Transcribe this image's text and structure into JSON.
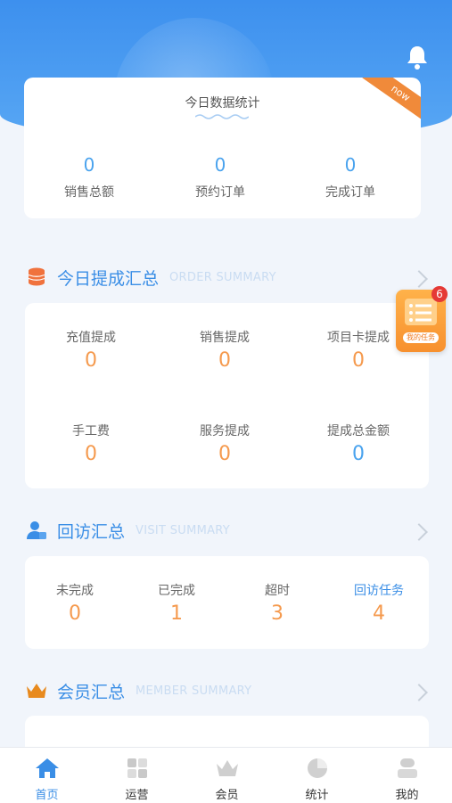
{
  "top": {
    "title": "今日数据统计",
    "ribbon": "now",
    "stats": [
      {
        "value": "0",
        "label": "销售总额"
      },
      {
        "value": "0",
        "label": "预约订单"
      },
      {
        "value": "0",
        "label": "完成订单"
      }
    ]
  },
  "commission": {
    "title": "今日提成汇总",
    "subtitle": "ORDER SUMMARY",
    "items": [
      {
        "label": "充值提成",
        "value": "0"
      },
      {
        "label": "销售提成",
        "value": "0"
      },
      {
        "label": "项目卡提成",
        "value": "0"
      },
      {
        "label": "手工费",
        "value": "0"
      },
      {
        "label": "服务提成",
        "value": "0"
      },
      {
        "label": "提成总金额",
        "value": "0"
      }
    ]
  },
  "visit": {
    "title": "回访汇总",
    "subtitle": "VISIT SUMMARY",
    "items": [
      {
        "label": "未完成",
        "value": "0"
      },
      {
        "label": "已完成",
        "value": "1"
      },
      {
        "label": "超时",
        "value": "3"
      },
      {
        "label": "回访任务",
        "value": "4"
      }
    ]
  },
  "member": {
    "title": "会员汇总",
    "subtitle": "MEMBER SUMMARY"
  },
  "task_float": {
    "badge": "6",
    "label": "我的任务"
  },
  "tabs": [
    {
      "label": "首页",
      "icon": "home-icon",
      "active": true
    },
    {
      "label": "运营",
      "icon": "grid-icon",
      "active": false
    },
    {
      "label": "会员",
      "icon": "crown-icon",
      "active": false
    },
    {
      "label": "统计",
      "icon": "pie-chart-icon",
      "active": false
    },
    {
      "label": "我的",
      "icon": "user-icon",
      "active": false
    }
  ],
  "colors": {
    "accent": "#3a8ee6",
    "orange": "#f59a4e",
    "header": "#4a9af0"
  }
}
